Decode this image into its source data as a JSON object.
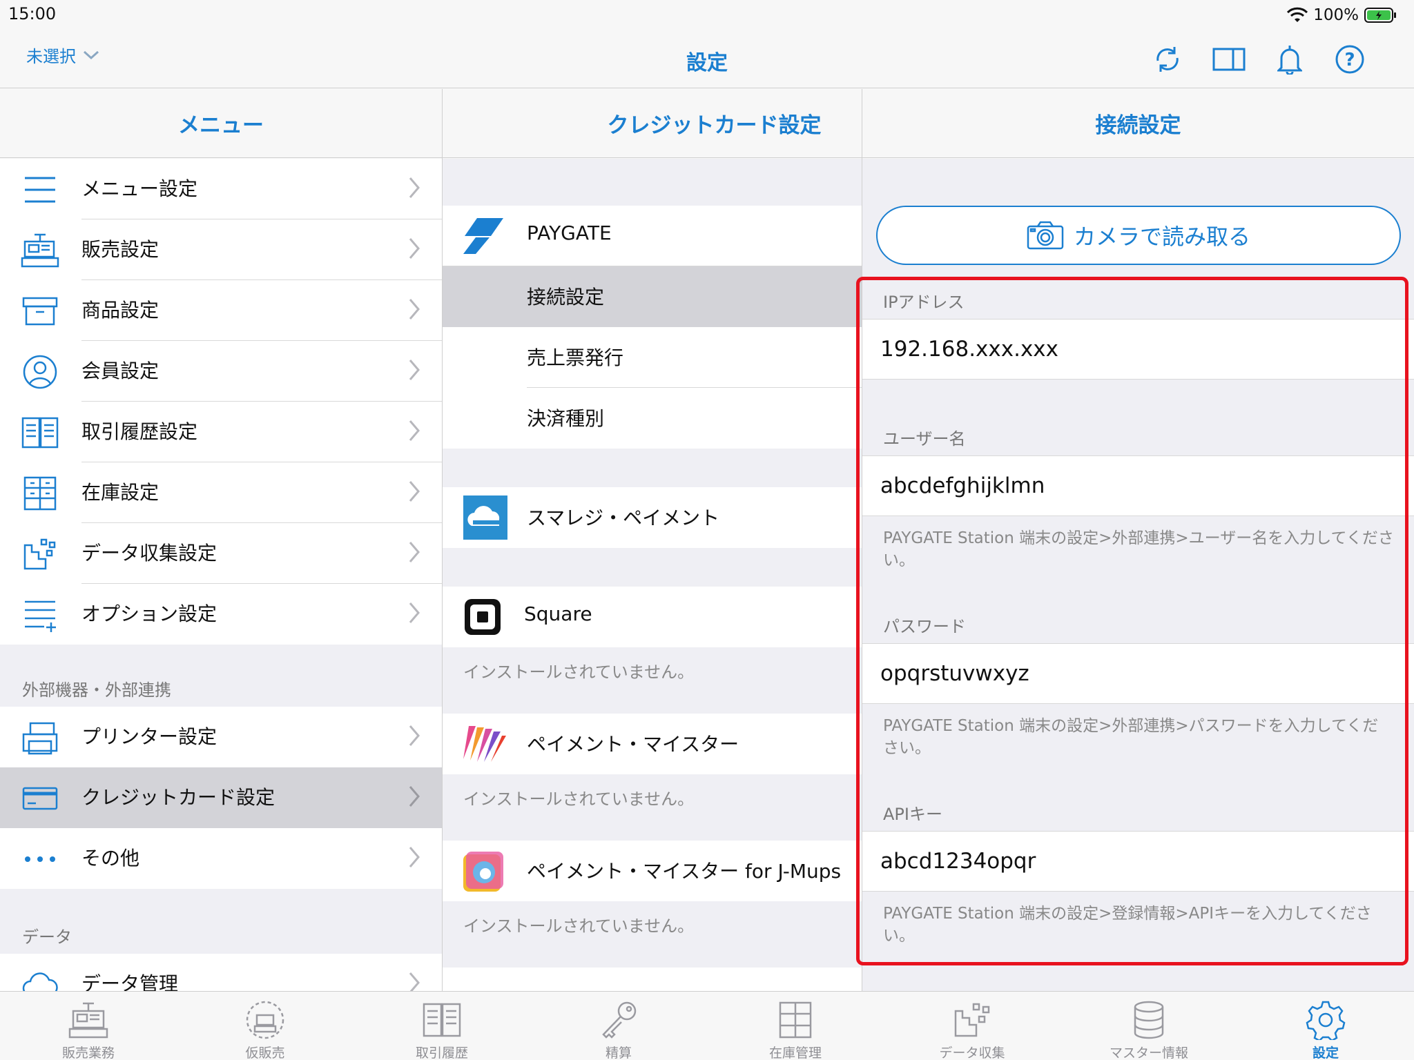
{
  "status": {
    "time": "15:00",
    "battery": "100%"
  },
  "nav": {
    "store_selector": "未選択",
    "title": "設定"
  },
  "columns": {
    "menu_title": "メニュー",
    "credit_title": "クレジットカード設定",
    "connection_title": "接続設定"
  },
  "menu": {
    "items": [
      {
        "label": "メニュー設定",
        "icon": "menu-lines-icon"
      },
      {
        "label": "販売設定",
        "icon": "register-icon"
      },
      {
        "label": "商品設定",
        "icon": "box-icon"
      },
      {
        "label": "会員設定",
        "icon": "user-icon"
      },
      {
        "label": "取引履歴設定",
        "icon": "book-icon"
      },
      {
        "label": "在庫設定",
        "icon": "shelves-icon"
      },
      {
        "label": "データ収集設定",
        "icon": "data-collect-icon"
      },
      {
        "label": "オプション設定",
        "icon": "option-list-icon"
      }
    ],
    "section_external": "外部機器・外部連携",
    "external_items": [
      {
        "label": "プリンター設定",
        "icon": "printer-icon"
      },
      {
        "label": "クレジットカード設定",
        "icon": "credit-card-icon",
        "selected": true
      },
      {
        "label": "その他",
        "icon": "more-dots-icon"
      }
    ],
    "section_data": "データ",
    "data_items": [
      {
        "label": "データ管理",
        "icon": "cloud-icon"
      }
    ]
  },
  "credit": {
    "paygate": "PAYGATE",
    "paygate_sub": [
      "接続設定",
      "売上票発行",
      "決済種別"
    ],
    "smaregi": "スマレジ・ペイメント",
    "square": "Square",
    "not_installed": "インストールされていません。",
    "payment_meister": "ペイメント・マイスター",
    "payment_meister_jmups": "ペイメント・マイスター for J-Mups"
  },
  "connection": {
    "camera_button": "カメラで読み取る",
    "ip_label": "IPアドレス",
    "ip_value": "192.168.xxx.xxx",
    "user_label": "ユーザー名",
    "user_value": "abcdefghijklmn",
    "user_note": "PAYGATE Station 端末の設定>外部連携>ユーザー名を入力してください。",
    "pass_label": "パスワード",
    "pass_value": "opqrstuvwxyz",
    "pass_note": "PAYGATE Station 端末の設定>外部連携>パスワードを入力してください。",
    "api_label": "APIキー",
    "api_value": "abcd1234opqr",
    "api_note": "PAYGATE Station 端末の設定>登録情報>APIキーを入力してください。"
  },
  "tabs": [
    {
      "label": "販売業務",
      "icon": "register-icon"
    },
    {
      "label": "仮販売",
      "icon": "temp-sale-icon"
    },
    {
      "label": "取引履歴",
      "icon": "book-icon"
    },
    {
      "label": "精算",
      "icon": "key-icon"
    },
    {
      "label": "在庫管理",
      "icon": "shelves-icon"
    },
    {
      "label": "データ収集",
      "icon": "data-collect-icon"
    },
    {
      "label": "マスター情報",
      "icon": "database-icon"
    },
    {
      "label": "設定",
      "icon": "gear-icon",
      "active": true
    }
  ],
  "colors": {
    "accent": "#1b7fd0",
    "highlight": "#e8121f",
    "selected_row": "#d3d3d8"
  }
}
